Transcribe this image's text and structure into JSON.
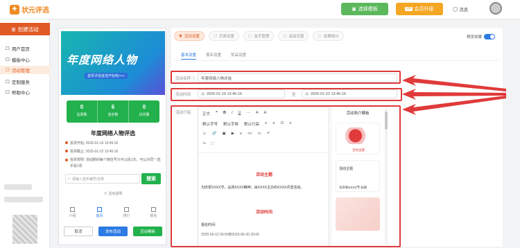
{
  "header": {
    "logo": "状元评选",
    "template_button": "选择模板",
    "vip_button": "会员升级",
    "message": "消息"
  },
  "sidebar": {
    "create": "创建活动",
    "items": [
      {
        "label": "用户首页"
      },
      {
        "label": "模板中心"
      },
      {
        "label": "活动管理"
      },
      {
        "label": "定制服务"
      },
      {
        "label": "帮助中心"
      }
    ]
  },
  "preview": {
    "banner_title": "年度网络人物",
    "banner_sub": "首票评选首选开始啦>>>",
    "stats": [
      {
        "value": "0",
        "label": "总票数"
      },
      {
        "value": "6",
        "label": "选手数"
      },
      {
        "value": "0",
        "label": "访问量"
      }
    ],
    "activity_title": "年度网络人物评选",
    "info": [
      "投票开始:  2025-01-16 13:45:16",
      "投票截止:  2025-01-22 13:45:16",
      "投票规则:  活动期间每个微信号只可以投1次，可以对同一选手投1票"
    ],
    "search_placeholder": "请输入选手编号/名称",
    "search_button": "搜索",
    "rules_link": "活动说明",
    "nav": [
      "介绍",
      "首页",
      "排行",
      "报名"
    ],
    "buttons": [
      "取消",
      "发布活动",
      "活动模板"
    ]
  },
  "editor": {
    "tabs": [
      "活动设置",
      "页面设置",
      "选手管理",
      "高级设置",
      "投票统计"
    ],
    "preview_toggle_label": "预览效果",
    "subtabs": [
      "基本设置",
      "报名设置",
      "奖品设置"
    ],
    "name_label": "活动名称",
    "name_value": "年度网络人物评选",
    "time_label": "活动时间",
    "time_start": "2025-01-16 13:45:16",
    "time_sep": "至",
    "time_end": "2025-01-22 13:45:16",
    "intro_label": "活动介绍",
    "toolbar": {
      "r1": [
        "正文",
        "❝",
        "B",
        "I",
        "U",
        "···",
        "A",
        "A"
      ],
      "r2": [
        "默认字号",
        "默认字体",
        "默认行高",
        "≡",
        "≡",
        "☑",
        "≡"
      ],
      "r3": [
        "☺",
        "🔗",
        "▣",
        "▶",
        "≡",
        "<>",
        "▭",
        "↶"
      ],
      "r4": [
        "↷",
        "⛶"
      ]
    },
    "content": {
      "heading1": "活动主题",
      "para1": "为庆祝XXXX节，弘扬XXXX精神，由XXXX主办的XXXX评选活动。",
      "heading2": "活动时间",
      "para2": "报名时间:",
      "para3": "2025-05-12 00:00到2025-06-20 20:00"
    },
    "template_panel": {
      "title": "活动简介模板",
      "card1_text": "活动主题",
      "card2_title": "活动主题",
      "card2_text": "为庆祝XXXX节 弘扬"
    }
  },
  "colors": {
    "accent": "#e05a24",
    "green": "#22b14c",
    "blue": "#2d7be5",
    "highlight": "#e03a3a"
  }
}
